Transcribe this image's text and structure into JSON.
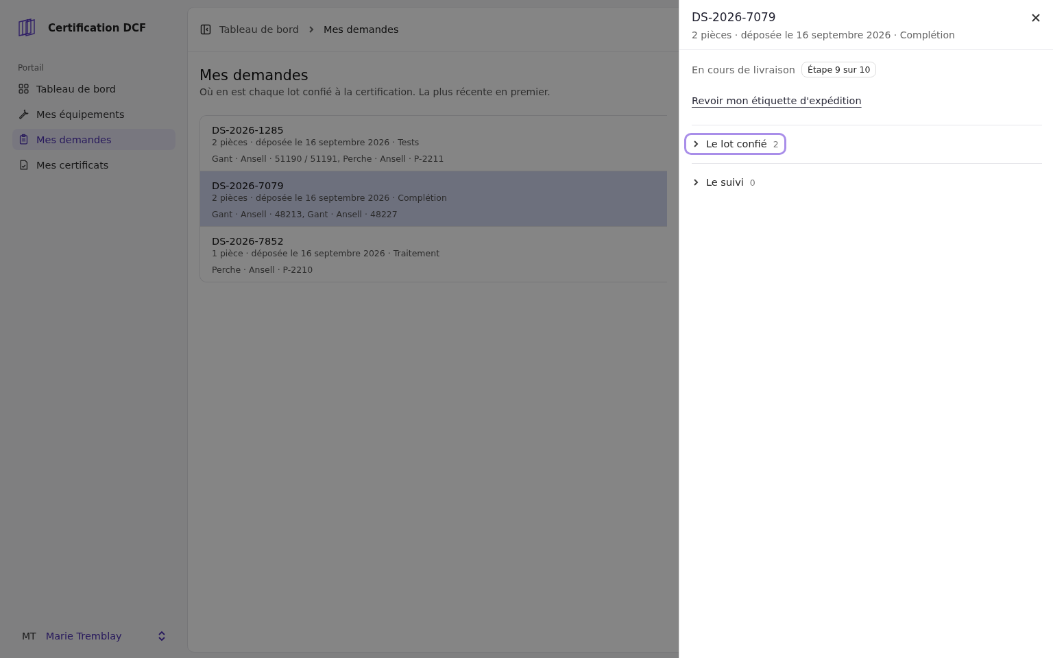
{
  "app": {
    "name": "Certification DCF"
  },
  "sidebar": {
    "section": "Portail",
    "items": [
      {
        "label": "Tableau de bord",
        "selected": false
      },
      {
        "label": "Mes équipements",
        "selected": false
      },
      {
        "label": "Mes demandes",
        "selected": true
      },
      {
        "label": "Mes certificats",
        "selected": false
      }
    ],
    "user": {
      "initials": "MT",
      "name": "Marie Tremblay"
    }
  },
  "breadcrumb": [
    "Tableau de bord",
    "Mes demandes"
  ],
  "page": {
    "title": "Mes demandes",
    "subtitle": "Où en est chaque lot confié à la certification. La plus récente en premier."
  },
  "requests": [
    {
      "id": "DS-2026-1285",
      "meta": "2 pièces · déposée le 16 septembre 2026 · Tests",
      "items": "Gant · Ansell · 51190 / 51191, Perche · Ansell · P-2211",
      "selected": false
    },
    {
      "id": "DS-2026-7079",
      "meta": "2 pièces · déposée le 16 septembre 2026 · Complétion",
      "items": "Gant · Ansell · 48213, Gant · Ansell · 48227",
      "selected": true
    },
    {
      "id": "DS-2026-7852",
      "meta": "1 pièce · déposée le 16 septembre 2026 · Traitement",
      "items": "Perche · Ansell · P-2210",
      "selected": false
    }
  ],
  "drawer": {
    "title": "DS-2026-7079",
    "subtitle": "2 pièces · déposée le 16 septembre 2026 · Complétion",
    "status": "En cours de livraison",
    "step": "Étape 9 sur 10",
    "link": "Revoir mon étiquette d'expédition",
    "sections": [
      {
        "label": "Le lot confié",
        "count": "2",
        "expanded": false,
        "focused": true
      },
      {
        "label": "Le suivi",
        "count": "0",
        "expanded": false,
        "focused": false
      }
    ]
  }
}
